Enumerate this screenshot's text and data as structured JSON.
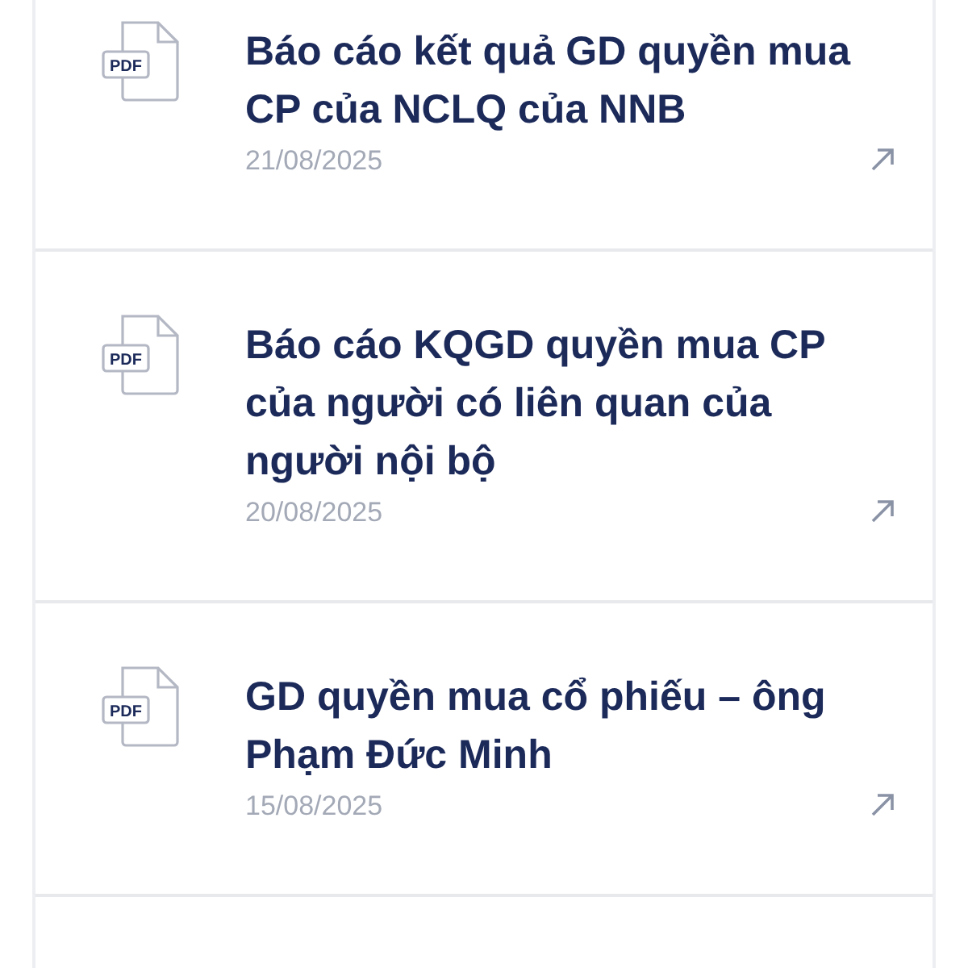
{
  "documents": [
    {
      "title": "Báo cáo kết quả GD quyền mua CP của NCLQ của NNB",
      "date": "21/08/2025",
      "file_type": "PDF"
    },
    {
      "title": "Báo cáo KQGD quyền mua CP của người có liên quan của người nội bộ",
      "date": "20/08/2025",
      "file_type": "PDF"
    },
    {
      "title": "GD quyền mua cổ phiếu – ông Phạm Đức Minh",
      "date": "15/08/2025",
      "file_type": "PDF"
    }
  ]
}
